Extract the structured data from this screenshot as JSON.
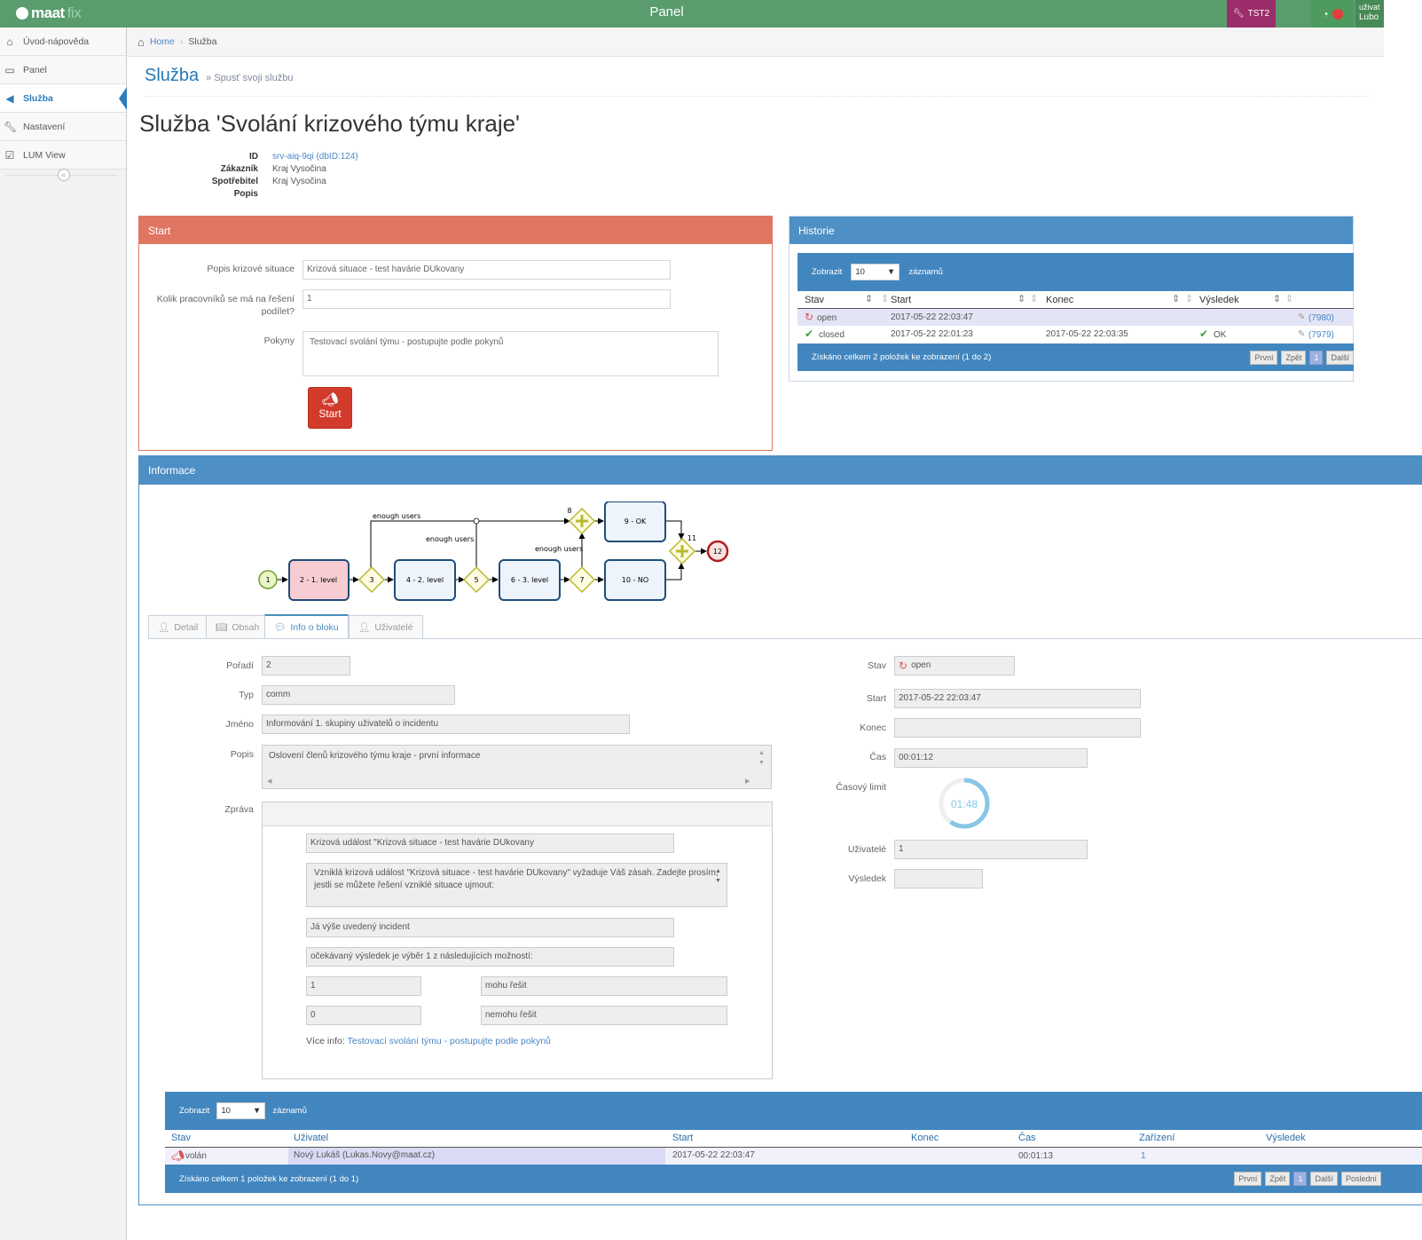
{
  "app": {
    "logo_text": "maat",
    "logo_suffix": "fix",
    "navbar_title": "Panel",
    "env_badge": "TST2",
    "user_line1": "uživat",
    "user_line2": "Lubo"
  },
  "colors": {
    "navbar": "#5a9c6d",
    "start_header": "#e07561",
    "blue_header": "#4e8fc6",
    "start_button": "#d23a2c"
  },
  "sidebar": {
    "items": [
      {
        "label": "Úvod-nápověda",
        "icon": "home-icon"
      },
      {
        "label": "Panel",
        "icon": "desktop-icon"
      },
      {
        "label": "Služba",
        "icon": "bullhorn-icon",
        "active": true
      },
      {
        "label": "Nastavení",
        "icon": "wrench-icon"
      },
      {
        "label": "LUM View",
        "icon": "check-square-icon"
      }
    ],
    "collapse": "«"
  },
  "breadcrumb": {
    "home": "Home",
    "current": "Služba"
  },
  "page": {
    "header": "Služba",
    "subheader": "» Spusť svoji službu",
    "title": "Služba 'Svolání krizového týmu kraje'"
  },
  "info": {
    "id_label": "ID",
    "id_value": "srv-aiq-9qi (dbID:124)",
    "customer_label": "Zákazník",
    "customer_value": "Kraj Vysočina",
    "consumer_label": "Spotřebitel",
    "consumer_value": "Kraj Vysočina",
    "desc_label": "Popis"
  },
  "start": {
    "header": "Start",
    "f1_label": "Popis krizové situace",
    "f1_value": "Krizová situace - test havárie DUkovany",
    "f2_label": "Kolik pracovníků se má na řešení podílet?",
    "f2_value": "1",
    "f3_label": "Pokyny",
    "f3_value": "Testovací svolání týmu - postupujte podle pokynů",
    "button": "Start"
  },
  "history": {
    "header": "Historie",
    "show": "Zobrazit",
    "page_size": "10",
    "records": "záznamů",
    "columns": [
      "Stav",
      "Start",
      "Konec",
      "Výsledek"
    ],
    "rows": [
      {
        "status": "open",
        "start": "2017-05-22 22:03:47",
        "end": "",
        "result": "",
        "link": "(7980)"
      },
      {
        "status": "closed",
        "start": "2017-05-22 22:01:23",
        "end": "2017-05-22 22:03:35",
        "result": "OK",
        "link": "(7979)"
      }
    ],
    "summary": "Získáno celkem 2 položek ke zobrazení (1 do 2)",
    "pager": [
      "První",
      "Zpět",
      "1",
      "Další"
    ]
  },
  "informace": {
    "header": "Informace"
  },
  "bpmn": {
    "start": "1",
    "end": "12",
    "tasks": [
      "2 - 1. level",
      "4 - 2. level",
      "6 - 3. level",
      "9 - OK",
      "10 - NO"
    ],
    "gateways": [
      "3",
      "5",
      "7",
      "8",
      "11"
    ],
    "edge_labels": [
      "enough users",
      "enough users",
      "enough users"
    ]
  },
  "tabs": [
    "Detail",
    "Obsah",
    "Info o bloku",
    "Uživatelé"
  ],
  "block": {
    "poradi_label": "Pořadí",
    "poradi": "2",
    "typ_label": "Typ",
    "typ": "comm",
    "jmeno_label": "Jméno",
    "jmeno": "Informování 1. skupiny uživatelů o incidentu",
    "popis_label": "Popis",
    "popis": "Oslovení členů krizového týmu kraje - první informace",
    "zprava_label": "Zpráva",
    "msg_subject": "Krizová událost \"Krizová situace - test havárie DUkovany",
    "msg_body": "Vzniklá krizová událost \"Krizová situace - test havárie DUkovany\" vyžaduje Váš zásah. Zadejte prosím, jestli se můžete řešení vzniklé situace ujmout:",
    "msg_line1": "Já výše uvedený incident",
    "msg_line2": "očekávaný výsledek je výběr 1  z následujících možností:",
    "opt1_key": "1",
    "opt1_val": "mohu řešit",
    "opt0_key": "0",
    "opt0_val": "nemohu řešit",
    "more_label": "Více info:",
    "more_link": "Testovací svolání týmu - postupujte podle pokynů",
    "stav_label": "Stav",
    "stav": "open",
    "start_label": "Start",
    "start": "2017-05-22 22:03:47",
    "konec_label": "Konec",
    "konec": "",
    "cas_label": "Čas",
    "cas": "00:01:12",
    "limit_label": "Časový limit",
    "limit": "01:48",
    "limit_fraction": 0.6,
    "users_label": "Uživatelé",
    "users": "1",
    "result_label": "Výsledek",
    "result": ""
  },
  "users_table": {
    "show": "Zobrazit",
    "page_size": "10",
    "records": "záznamů",
    "columns": [
      "Stav",
      "Uživatel",
      "Start",
      "Konec",
      "Čas",
      "Zařízení",
      "Výsledek"
    ],
    "rows": [
      {
        "status": "volán",
        "user": "Nový Lukáš (Lukas.Novy@maat.cz)",
        "start": "2017-05-22 22:03:47",
        "end": "",
        "time": "00:01:13",
        "device": "1",
        "result": ""
      }
    ],
    "summary": "Získáno celkem 1 položek ke zobrazení (1 do 1)",
    "pager": [
      "První",
      "Zpět",
      "1",
      "Další",
      "Poslední"
    ]
  }
}
